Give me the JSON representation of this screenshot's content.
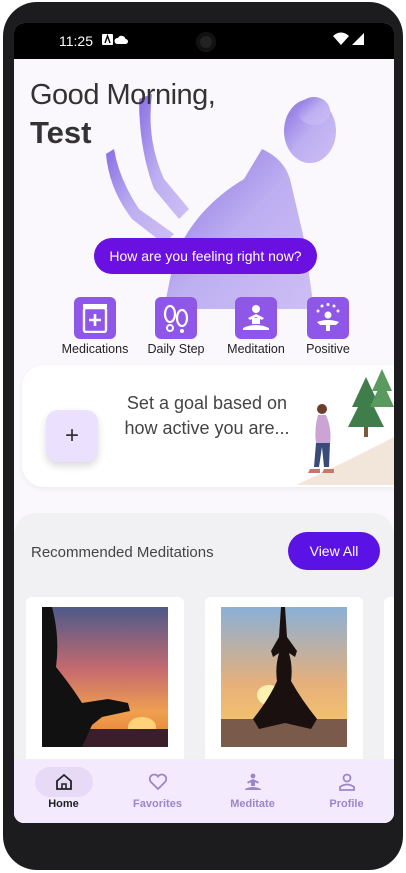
{
  "status_bar": {
    "time": "11:25"
  },
  "header": {
    "greeting": "Good Morning,",
    "user_name": "Test"
  },
  "feeling_button": "How are you feeling right now?",
  "quick_actions": [
    {
      "label": "Medications",
      "icon": "medication-icon"
    },
    {
      "label": "Daily Step",
      "icon": "footsteps-icon"
    },
    {
      "label": "Meditation",
      "icon": "meditation-icon"
    },
    {
      "label": "Positive",
      "icon": "positive-icon"
    }
  ],
  "goal_card": {
    "text": "Set a goal based on how active you are...",
    "add_symbol": "+"
  },
  "recommended": {
    "title": "Recommended Meditations",
    "view_all": "View All"
  },
  "bottom_nav": [
    {
      "label": "Home",
      "icon": "home-icon",
      "active": true
    },
    {
      "label": "Favorites",
      "icon": "heart-icon",
      "active": false
    },
    {
      "label": "Meditate",
      "icon": "meditate-icon",
      "active": false
    },
    {
      "label": "Profile",
      "icon": "profile-icon",
      "active": false
    }
  ],
  "colors": {
    "accent": "#6a10e0",
    "tile": "#8e57e8",
    "nav_bg": "#f3ebfd"
  }
}
